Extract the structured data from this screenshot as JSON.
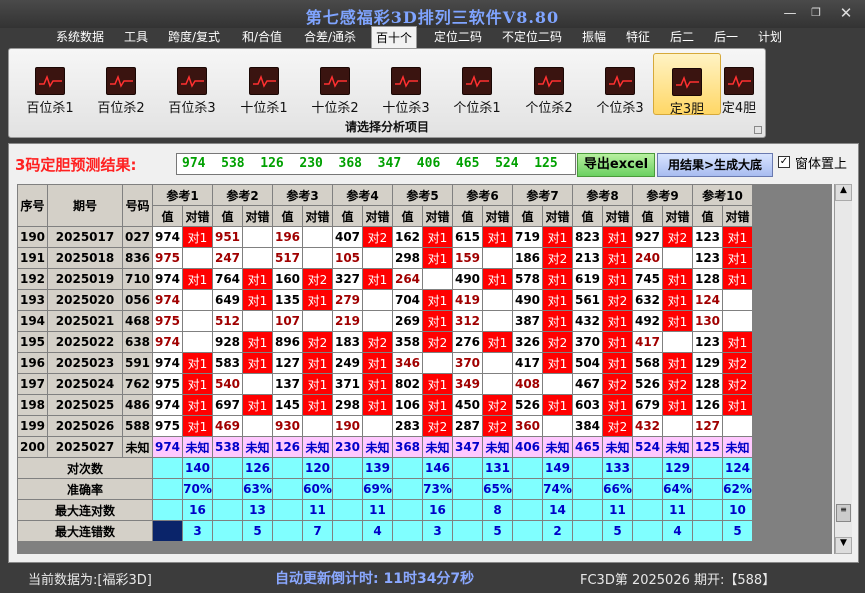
{
  "window": {
    "title": "第七感福彩3D排列三软件V8.80"
  },
  "menu": [
    "系统数据",
    "工具",
    "跨度/复式",
    "和/合值",
    "合差/通杀",
    "百十个",
    "定位二码",
    "不定位二码",
    "振幅",
    "特征",
    "后二",
    "后一",
    "计划"
  ],
  "menu_active": "百十个",
  "ribbon": {
    "buttons": [
      "百位杀1",
      "百位杀2",
      "百位杀3",
      "十位杀1",
      "十位杀2",
      "十位杀3",
      "个位杀1",
      "个位杀2",
      "个位杀3",
      "定3胆",
      "定4胆"
    ],
    "selected": "定3胆",
    "caption": "请选择分析项目"
  },
  "result": {
    "label": "3码定胆预测结果:",
    "value": "974  538  126  230  368  347  406  465  524  125",
    "excel_button": "导出excel",
    "gen_button": "用结果>生成大底",
    "topmost_label": "窗体置上",
    "topmost_checked": "✓"
  },
  "table": {
    "h_seq": "序号",
    "h_issue": "期号",
    "h_code": "号码",
    "refs": [
      "参考1",
      "参考2",
      "参考3",
      "参考4",
      "参考5",
      "参考6",
      "参考7",
      "参考8",
      "参考9",
      "参考10"
    ],
    "sub_val": "值",
    "sub_hit": "对错",
    "rows": [
      {
        "seq": "190",
        "issue": "2025017",
        "code": "027",
        "cells": [
          [
            "974",
            "对1"
          ],
          [
            "951",
            ""
          ],
          [
            "196",
            ""
          ],
          [
            "407",
            "对2"
          ],
          [
            "162",
            "对1"
          ],
          [
            "615",
            "对1"
          ],
          [
            "719",
            "对1"
          ],
          [
            "823",
            "对1"
          ],
          [
            "927",
            "对2"
          ],
          [
            "123",
            "对1"
          ]
        ]
      },
      {
        "seq": "191",
        "issue": "2025018",
        "code": "836",
        "cells": [
          [
            "975",
            ""
          ],
          [
            "247",
            ""
          ],
          [
            "517",
            ""
          ],
          [
            "105",
            ""
          ],
          [
            "298",
            "对1"
          ],
          [
            "159",
            ""
          ],
          [
            "186",
            "对2"
          ],
          [
            "213",
            "对1"
          ],
          [
            "240",
            ""
          ],
          [
            "123",
            "对1"
          ]
        ]
      },
      {
        "seq": "192",
        "issue": "2025019",
        "code": "710",
        "cells": [
          [
            "974",
            "对1"
          ],
          [
            "764",
            "对1"
          ],
          [
            "160",
            "对2"
          ],
          [
            "327",
            "对1"
          ],
          [
            "264",
            ""
          ],
          [
            "490",
            "对1"
          ],
          [
            "578",
            "对1"
          ],
          [
            "619",
            "对1"
          ],
          [
            "745",
            "对1"
          ],
          [
            "128",
            "对1"
          ]
        ]
      },
      {
        "seq": "193",
        "issue": "2025020",
        "code": "056",
        "cells": [
          [
            "974",
            ""
          ],
          [
            "649",
            "对1"
          ],
          [
            "135",
            "对1"
          ],
          [
            "279",
            ""
          ],
          [
            "704",
            "对1"
          ],
          [
            "419",
            ""
          ],
          [
            "490",
            "对1"
          ],
          [
            "561",
            "对2"
          ],
          [
            "632",
            "对1"
          ],
          [
            "124",
            ""
          ]
        ]
      },
      {
        "seq": "194",
        "issue": "2025021",
        "code": "468",
        "cells": [
          [
            "975",
            ""
          ],
          [
            "512",
            ""
          ],
          [
            "107",
            ""
          ],
          [
            "219",
            ""
          ],
          [
            "269",
            "对1"
          ],
          [
            "312",
            ""
          ],
          [
            "387",
            "对1"
          ],
          [
            "432",
            "对1"
          ],
          [
            "492",
            "对1"
          ],
          [
            "130",
            ""
          ]
        ]
      },
      {
        "seq": "195",
        "issue": "2025022",
        "code": "638",
        "cells": [
          [
            "974",
            ""
          ],
          [
            "928",
            "对1"
          ],
          [
            "896",
            "对2"
          ],
          [
            "183",
            "对2"
          ],
          [
            "358",
            "对2"
          ],
          [
            "276",
            "对1"
          ],
          [
            "326",
            "对2"
          ],
          [
            "370",
            "对1"
          ],
          [
            "417",
            ""
          ],
          [
            "123",
            "对1"
          ]
        ]
      },
      {
        "seq": "196",
        "issue": "2025023",
        "code": "591",
        "cells": [
          [
            "974",
            "对1"
          ],
          [
            "583",
            "对1"
          ],
          [
            "127",
            "对1"
          ],
          [
            "249",
            "对1"
          ],
          [
            "346",
            ""
          ],
          [
            "370",
            ""
          ],
          [
            "417",
            "对1"
          ],
          [
            "504",
            "对1"
          ],
          [
            "568",
            "对1"
          ],
          [
            "129",
            "对2"
          ]
        ]
      },
      {
        "seq": "197",
        "issue": "2025024",
        "code": "762",
        "cells": [
          [
            "975",
            "对1"
          ],
          [
            "540",
            ""
          ],
          [
            "137",
            "对1"
          ],
          [
            "371",
            "对1"
          ],
          [
            "802",
            "对1"
          ],
          [
            "349",
            ""
          ],
          [
            "408",
            ""
          ],
          [
            "467",
            "对2"
          ],
          [
            "526",
            "对2"
          ],
          [
            "128",
            "对2"
          ]
        ]
      },
      {
        "seq": "198",
        "issue": "2025025",
        "code": "486",
        "cells": [
          [
            "974",
            "对1"
          ],
          [
            "697",
            "对1"
          ],
          [
            "145",
            "对1"
          ],
          [
            "298",
            "对1"
          ],
          [
            "106",
            "对1"
          ],
          [
            "450",
            "对2"
          ],
          [
            "526",
            "对1"
          ],
          [
            "603",
            "对1"
          ],
          [
            "679",
            "对1"
          ],
          [
            "126",
            "对1"
          ]
        ]
      },
      {
        "seq": "199",
        "issue": "2025026",
        "code": "588",
        "cells": [
          [
            "975",
            "对1"
          ],
          [
            "469",
            ""
          ],
          [
            "930",
            ""
          ],
          [
            "190",
            ""
          ],
          [
            "283",
            "对2"
          ],
          [
            "287",
            "对2"
          ],
          [
            "360",
            ""
          ],
          [
            "384",
            "对2"
          ],
          [
            "432",
            ""
          ],
          [
            "127",
            ""
          ]
        ]
      }
    ],
    "last": {
      "seq": "200",
      "issue": "2025027",
      "code": "未知",
      "cells": [
        [
          "974",
          "未知"
        ],
        [
          "538",
          "未知"
        ],
        [
          "126",
          "未知"
        ],
        [
          "230",
          "未知"
        ],
        [
          "368",
          "未知"
        ],
        [
          "347",
          "未知"
        ],
        [
          "406",
          "未知"
        ],
        [
          "465",
          "未知"
        ],
        [
          "524",
          "未知"
        ],
        [
          "125",
          "未知"
        ]
      ]
    },
    "stats": [
      {
        "label": "对次数",
        "values": [
          "140",
          "126",
          "120",
          "139",
          "146",
          "131",
          "149",
          "133",
          "129",
          "124"
        ]
      },
      {
        "label": "准确率",
        "values": [
          "70%",
          "63%",
          "60%",
          "69%",
          "73%",
          "65%",
          "74%",
          "66%",
          "64%",
          "62%"
        ]
      },
      {
        "label": "最大连对数",
        "values": [
          "16",
          "13",
          "11",
          "11",
          "16",
          "8",
          "14",
          "11",
          "11",
          "10"
        ]
      },
      {
        "label": "最大连错数",
        "values": [
          "3",
          "5",
          "7",
          "4",
          "3",
          "5",
          "2",
          "5",
          "4",
          "5"
        ]
      }
    ]
  },
  "status": {
    "left": "当前数据为:[福彩3D]",
    "countdown": "自动更新倒计时:  11时34分7秒",
    "right": "FC3D第 2025026 期开:【588】"
  },
  "colors": {
    "hit": "#ff0000",
    "stat_bg": "#80ffff",
    "last_bg": "#ffc8ff",
    "title": "#7fa4ff"
  }
}
